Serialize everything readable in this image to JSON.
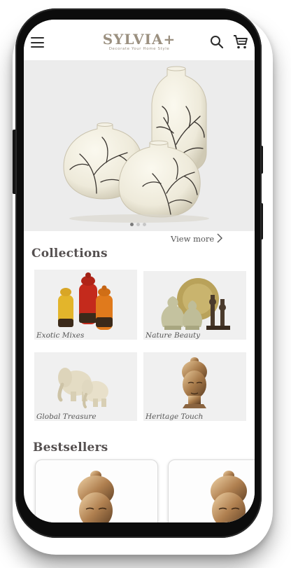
{
  "header": {
    "brand_name": "SYLVIA+",
    "brand_tagline": "Decorate Your Home Style",
    "menu_icon": "hamburger-menu-icon",
    "search_icon": "search-icon",
    "cart_icon": "shopping-cart-icon"
  },
  "hero": {
    "slide_count": 3,
    "active_slide": 1
  },
  "collections": {
    "title": "Collections",
    "view_more": "View more",
    "items": [
      {
        "label": "Exotic Mixes"
      },
      {
        "label": "Nature Beauty"
      },
      {
        "label": "Global Treasure"
      },
      {
        "label": "Heritage Touch"
      }
    ]
  },
  "bestsellers": {
    "title": "Bestsellers"
  },
  "colors": {
    "brand": "#9b9080",
    "text_dark": "#555050",
    "hero_bg": "#ececec",
    "card_bg": "#f0f0f0"
  }
}
